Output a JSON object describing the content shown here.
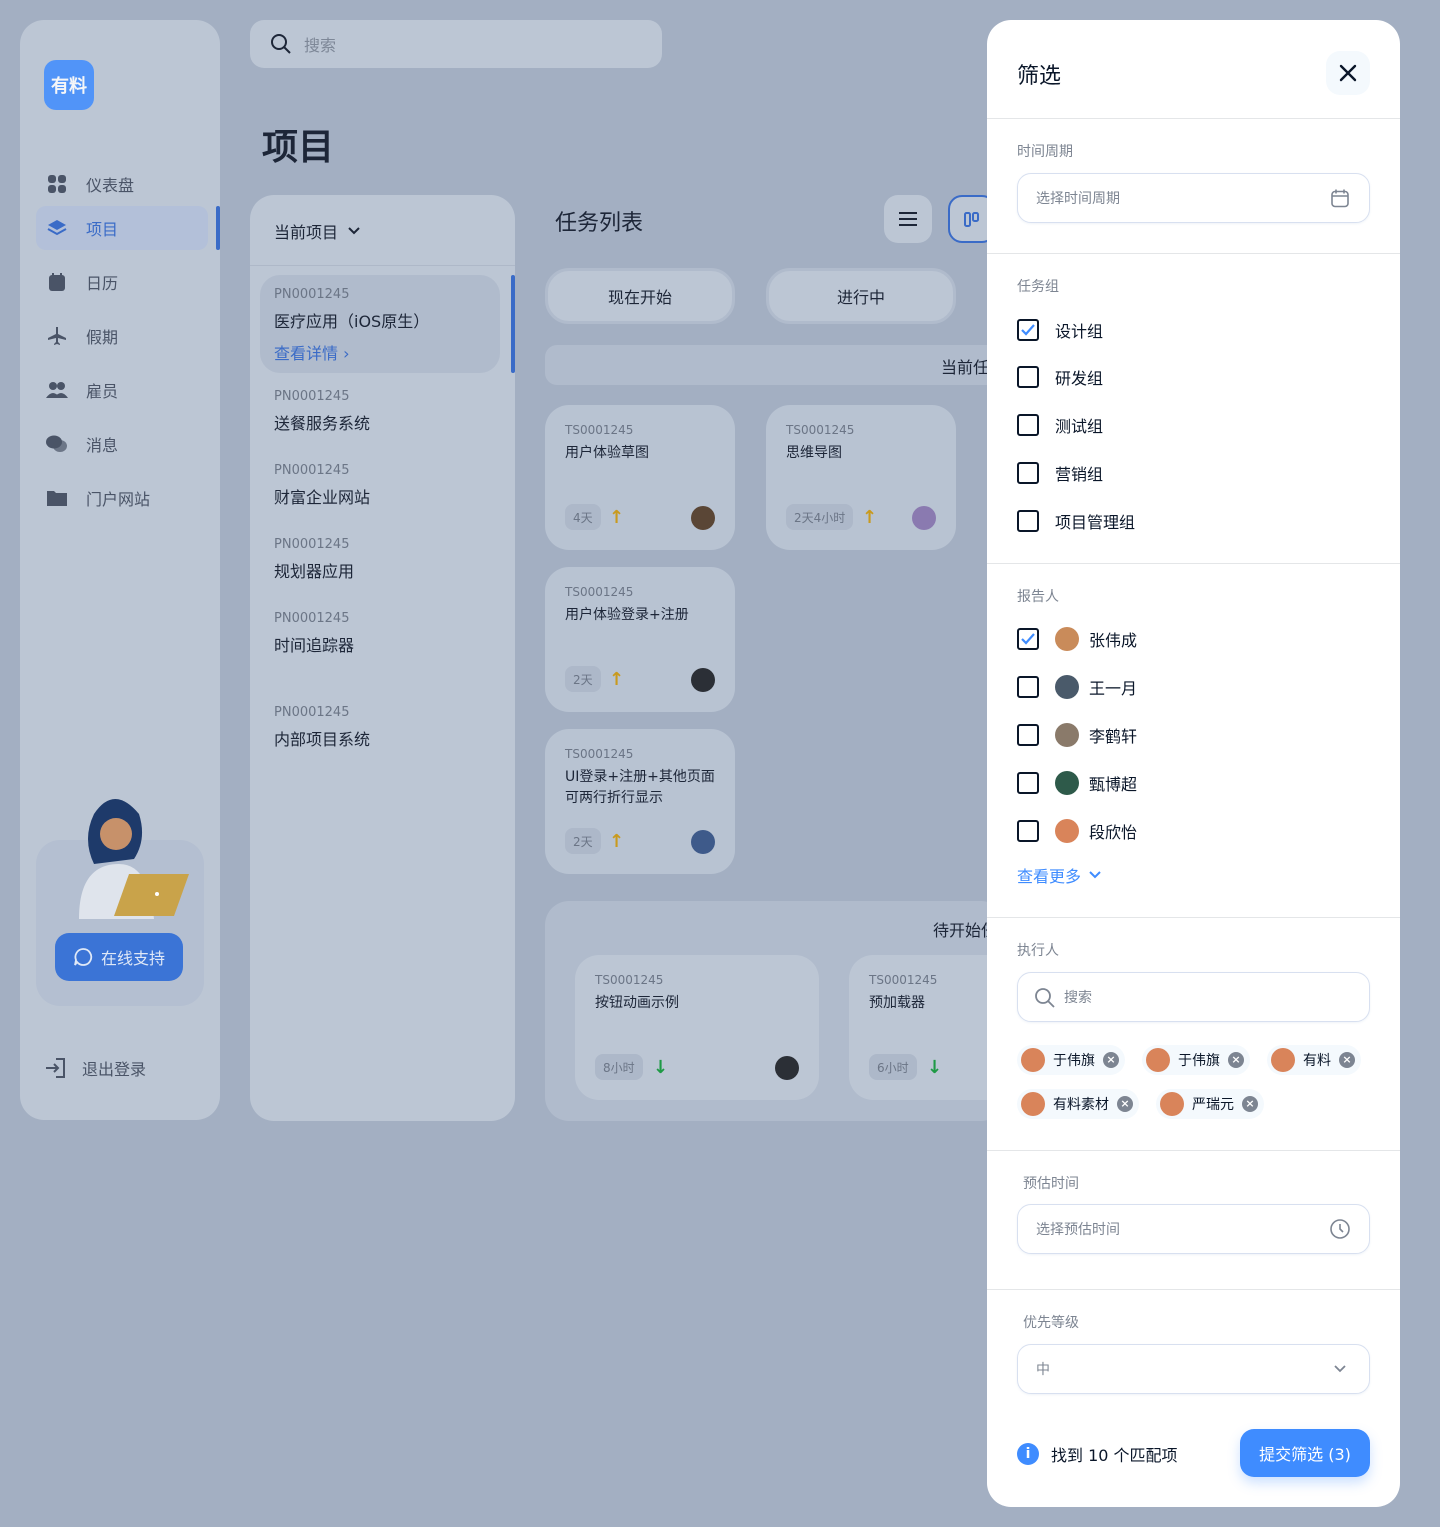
{
  "colors": {
    "accent": "#3f8cff",
    "overlay": "#a3afc2",
    "panel": "#ffffff"
  },
  "background": {
    "brand_logo_text": "有料",
    "search_placeholder": "搜索",
    "page_title": "项目",
    "nav": [
      {
        "label": "仪表盘",
        "icon": "dashboard-icon"
      },
      {
        "label": "项目",
        "icon": "layers-icon",
        "active": true
      },
      {
        "label": "日历",
        "icon": "calendar-icon"
      },
      {
        "label": "假期",
        "icon": "airplane-icon"
      },
      {
        "label": "雇员",
        "icon": "users-icon"
      },
      {
        "label": "消息",
        "icon": "chat-icon"
      },
      {
        "label": "门户网站",
        "icon": "folder-icon"
      }
    ],
    "support_button": "在线支持",
    "logout": "退出登录",
    "projects_header": "当前项目",
    "projects": [
      {
        "id": "PN0001245",
        "name": "医疗应用（iOS原生）",
        "link": "查看详情"
      },
      {
        "id": "PN0001245",
        "name": "送餐服务系统"
      },
      {
        "id": "PN0001245",
        "name": "财富企业网站"
      },
      {
        "id": "PN0001245",
        "name": "规划器应用"
      },
      {
        "id": "PN0001245",
        "name": "时间追踪器"
      },
      {
        "id": "PN0001245",
        "name": "内部项目系统"
      }
    ],
    "tasks_title": "任务列表",
    "status_pills": [
      "现在开始",
      "进行中"
    ],
    "current_label": "当前任",
    "todo_label": "待开始任",
    "tasks": [
      {
        "id": "TS0001245",
        "name": "用户体验草图",
        "estimate": "4天",
        "direction": "up"
      },
      {
        "id": "TS0001245",
        "name": "思维导图",
        "estimate": "2天4小时",
        "direction": "up"
      },
      {
        "id": "TS0001245",
        "name": "用户体验登录+注册",
        "estimate": "2天",
        "direction": "up"
      },
      {
        "id": "TS0001245",
        "name": "UI登录+注册+其他页面可两行折行显示",
        "estimate": "2天",
        "direction": "up"
      },
      {
        "id": "TS0001245",
        "name": "按钮动画示例",
        "estimate": "8小时",
        "direction": "down"
      },
      {
        "id": "TS0001245",
        "name": "预加载器",
        "estimate": "6小时",
        "direction": "down"
      }
    ]
  },
  "filter": {
    "title": "筛选",
    "period": {
      "label": "时间周期",
      "placeholder": "选择时间周期"
    },
    "groups": {
      "label": "任务组",
      "items": [
        {
          "label": "设计组",
          "checked": true
        },
        {
          "label": "研发组",
          "checked": false
        },
        {
          "label": "测试组",
          "checked": false
        },
        {
          "label": "营销组",
          "checked": false
        },
        {
          "label": "项目管理组",
          "checked": false
        }
      ]
    },
    "reporters": {
      "label": "报告人",
      "items": [
        {
          "label": "张伟成",
          "checked": true,
          "avatar_color": "#c98b5a"
        },
        {
          "label": "王一月",
          "checked": false,
          "avatar_color": "#4a5a6a"
        },
        {
          "label": "李鹤轩",
          "checked": false,
          "avatar_color": "#8a7a6a"
        },
        {
          "label": "甄博超",
          "checked": false,
          "avatar_color": "#2e5a4a"
        },
        {
          "label": "段欣怡",
          "checked": false,
          "avatar_color": "#d9845a"
        }
      ],
      "more": "查看更多"
    },
    "assignees": {
      "label": "执行人",
      "placeholder": "搜索",
      "chips": [
        "于伟旗",
        "于伟旗",
        "有料",
        "有料素材",
        "严瑞元"
      ]
    },
    "estimate": {
      "label": "预估时间",
      "placeholder": "选择预估时间"
    },
    "priority": {
      "label": "优先等级",
      "value": "中"
    },
    "footer": {
      "matches": "找到 10 个匹配项",
      "submit": "提交筛选 (3)"
    }
  }
}
